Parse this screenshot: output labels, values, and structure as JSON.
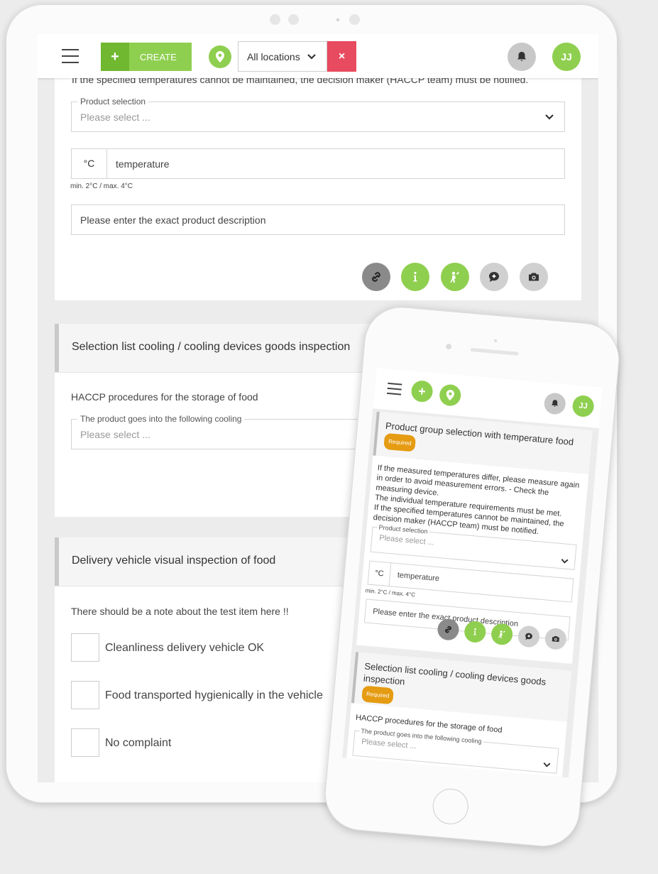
{
  "tablet": {
    "appbar": {
      "create_label": "CREATE",
      "create_plus": "+",
      "location_value": "All locations",
      "clear_glyph": "×",
      "avatar_initials": "JJ"
    },
    "card1": {
      "cut_text": "If the specified temperatures cannot be maintained, the decision maker (HACCP team) must be notified.",
      "product_label": "Product selection",
      "product_placeholder": "Please select ...",
      "temp_unit": "°C",
      "temp_placeholder": "temperature",
      "temp_hint": "min. 2°C / max. 4°C",
      "desc_placeholder": "Please enter the exact product description"
    },
    "card2": {
      "title": "Selection list cooling / cooling devices goods inspection",
      "subtitle": "HACCP procedures for the storage of food",
      "select_label": "The product goes into the following cooling",
      "select_placeholder": "Please select ..."
    },
    "card3": {
      "title": "Delivery vehicle visual inspection of food",
      "note": "There should be a note about the test item here !!",
      "checks": [
        "Cleanliness delivery vehicle OK",
        "Food transported hygienically in the vehicle",
        "No complaint"
      ]
    }
  },
  "phone": {
    "avatar_initials": "JJ",
    "card1": {
      "title": "Product group selection with temperature food",
      "required": "Required",
      "desc_lines": [
        "If the measured temperatures differ, please measure again",
        "in order to avoid measurement errors. - Check the",
        "measuring device.",
        "The individual temperature requirements must be met.",
        "If the specified temperatures cannot be maintained, the",
        "decision maker (HACCP team) must be notified."
      ],
      "product_label": "Product selection",
      "product_placeholder": "Please select ...",
      "temp_unit": "°C",
      "temp_placeholder": "temperature",
      "temp_hint": "min. 2°C / max. 4°C",
      "desc_placeholder": "Please enter the exact product description"
    },
    "card2": {
      "title": "Selection list cooling / cooling devices goods inspection",
      "required": "Required",
      "subtitle": "HACCP procedures for the storage of food",
      "select_label": "The product goes into the following cooling",
      "select_placeholder": "Please select ..."
    }
  },
  "colors": {
    "green": "#8fcf4f",
    "green_dark": "#6fb830",
    "red": "#e84a5f",
    "required_orange": "#e59b12"
  },
  "icons": [
    "menu-icon",
    "plus-icon",
    "location-pin-icon",
    "chevron-down-icon",
    "close-icon",
    "bell-icon",
    "link-icon",
    "info-icon",
    "person-icon",
    "comment-plus-icon",
    "camera-icon"
  ]
}
